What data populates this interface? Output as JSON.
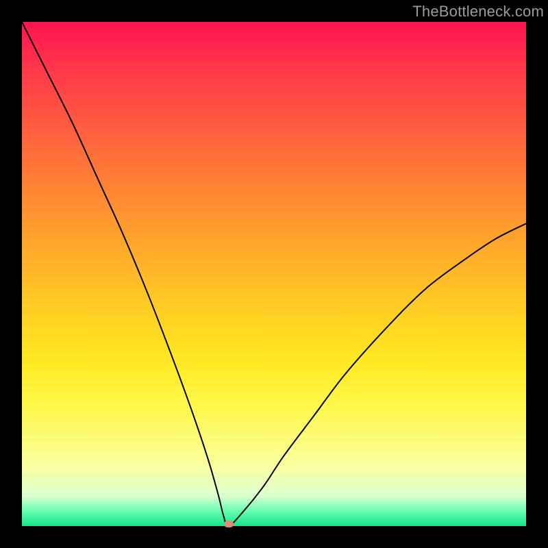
{
  "watermark": {
    "text": "TheBottleneck.com"
  },
  "colors": {
    "frame": "#000000",
    "curve": "#000000",
    "marker": "#e08a78",
    "gradient_stops": [
      "#ff1450",
      "#ff3a4a",
      "#ff6a3c",
      "#ff9a2e",
      "#ffc825",
      "#ffe822",
      "#fff84a",
      "#f9ffa0",
      "#dcffd0",
      "#64ffb0",
      "#18e488"
    ]
  },
  "chart_data": {
    "type": "line",
    "title": "",
    "xlabel": "",
    "ylabel": "",
    "xlim": [
      0,
      100
    ],
    "ylim": [
      0,
      100
    ],
    "grid": false,
    "legend": false,
    "notes": "V-shaped bottleneck curve. Minimum near x≈41, y≈0. Left branch starts near (0,100); right branch ends near (100,60). Small flat segment at the trough.",
    "min_point": {
      "x": 41,
      "y": 0
    },
    "series": [
      {
        "name": "bottleneck",
        "x": [
          0,
          5,
          10,
          15,
          20,
          25,
          30,
          34,
          37,
          39,
          40,
          41,
          44,
          48,
          52,
          58,
          64,
          72,
          80,
          88,
          94,
          100
        ],
        "y": [
          100,
          90,
          80,
          69,
          58,
          46,
          33,
          22,
          13,
          6,
          2,
          0,
          3,
          8,
          14,
          22,
          30,
          39,
          47,
          53,
          57,
          60
        ]
      }
    ]
  }
}
